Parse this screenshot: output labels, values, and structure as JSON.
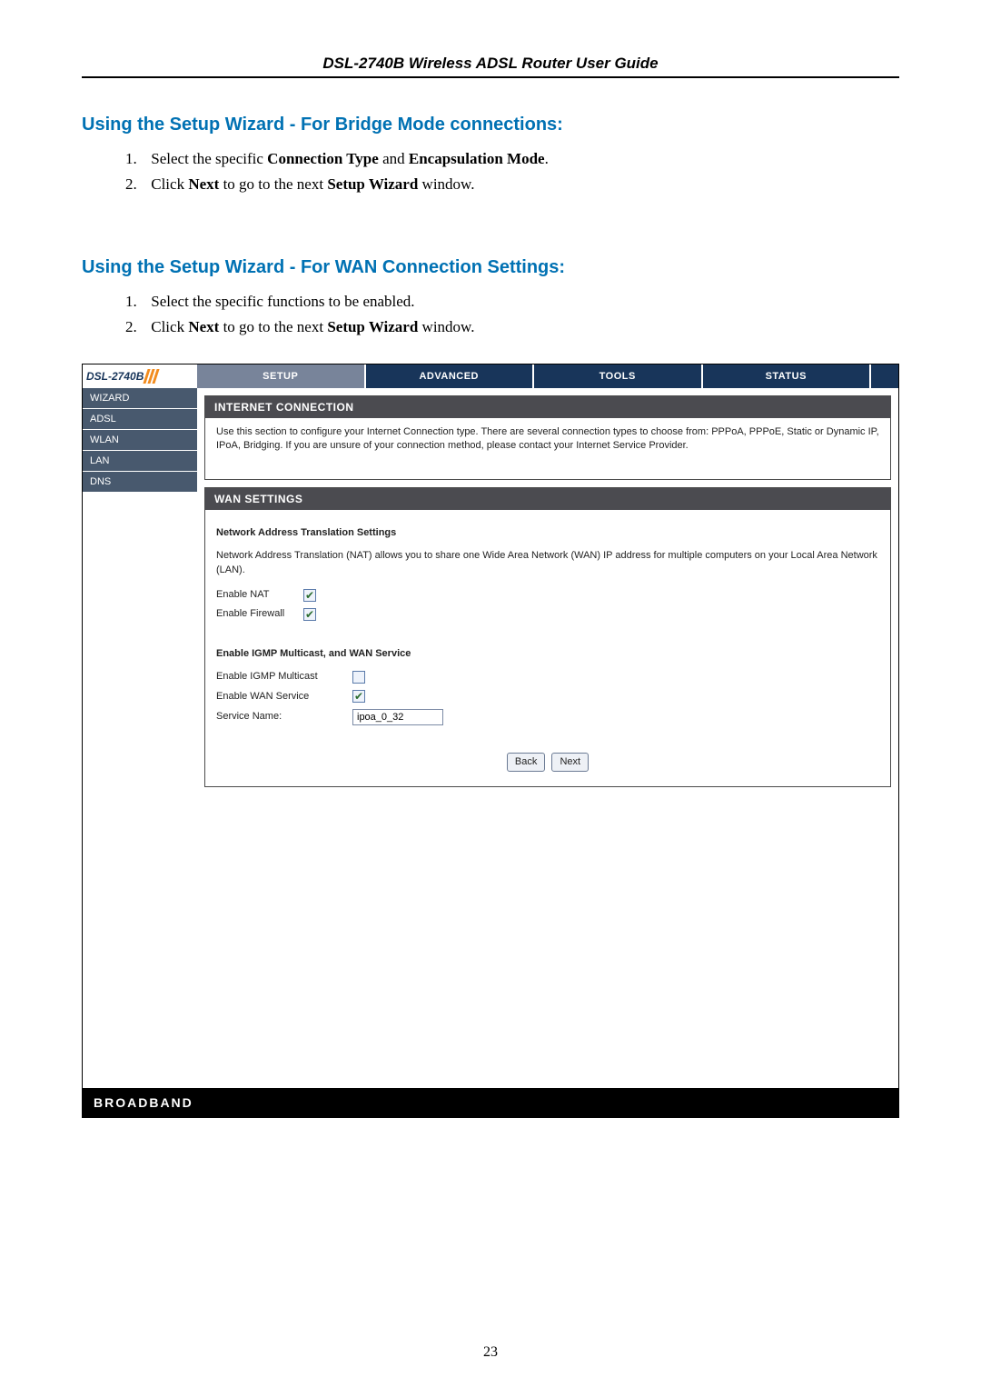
{
  "header": {
    "guide_title": "DSL-2740B Wireless ADSL Router User Guide"
  },
  "section1": {
    "heading": "Using the Setup Wizard - For Bridge Mode connections:",
    "steps": [
      {
        "num": "1.",
        "pre": "Select the specific ",
        "b1": "Connection Type",
        "mid": " and ",
        "b2": "Encapsulation Mode",
        "post": "."
      },
      {
        "num": "2.",
        "pre": "Click ",
        "b1": "Next",
        "mid": " to go to the next ",
        "b2": "Setup Wizard",
        "post": " window."
      }
    ]
  },
  "section2": {
    "heading": "Using the Setup Wizard - For WAN Connection Settings:",
    "steps": [
      {
        "num": "1.",
        "pre": "Select the specific functions to be enabled.",
        "b1": "",
        "mid": "",
        "b2": "",
        "post": ""
      },
      {
        "num": "2.",
        "pre": "Click ",
        "b1": "Next",
        "mid": " to go to the next ",
        "b2": "Setup Wizard",
        "post": " window."
      }
    ]
  },
  "ui": {
    "logo": "DSL-2740B",
    "topnav": [
      "SETUP",
      "ADVANCED",
      "TOOLS",
      "STATUS"
    ],
    "topnav_active": 0,
    "leftnav": [
      "WIZARD",
      "ADSL",
      "WLAN",
      "LAN",
      "DNS"
    ],
    "leftnav_active": -1,
    "panel1": {
      "title": "INTERNET CONNECTION",
      "desc": "Use this section to configure your Internet Connection type. There are several connection types to choose from: PPPoA, PPPoE, Static or Dynamic IP, IPoA, Bridging. If you are unsure of your connection method, please contact your Internet Service Provider."
    },
    "panel2": {
      "title": "WAN SETTINGS",
      "nat_heading": "Network Address Translation Settings",
      "nat_desc": "Network Address Translation (NAT) allows you to share one Wide Area Network (WAN) IP address for multiple computers on your Local Area Network (LAN).",
      "enable_nat_label": "Enable NAT",
      "enable_nat_checked": true,
      "enable_firewall_label": "Enable Firewall",
      "enable_firewall_checked": true,
      "igmp_heading": "Enable IGMP Multicast, and WAN Service",
      "enable_igmp_label": "Enable IGMP Multicast",
      "enable_igmp_checked": false,
      "enable_wan_label": "Enable WAN Service",
      "enable_wan_checked": true,
      "service_name_label": "Service Name:",
      "service_name_value": "ipoa_0_32",
      "back_label": "Back",
      "next_label": "Next"
    },
    "footer": "BROADBAND"
  },
  "page_number": "23"
}
